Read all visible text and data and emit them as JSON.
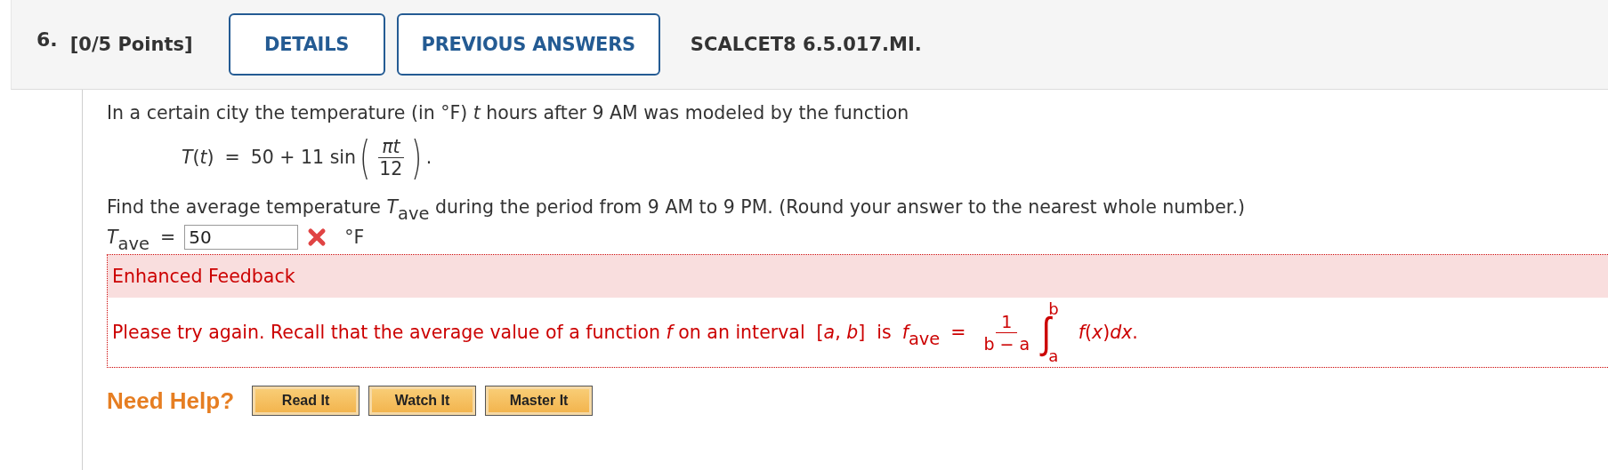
{
  "header": {
    "number": "6.",
    "points": "[0/5 Points]",
    "buttons": [
      "DETAILS",
      "PREVIOUS ANSWERS"
    ],
    "problem_id": "SCALCET8 6.5.017.MI."
  },
  "question": {
    "intro": "In a certain city the temperature (in °F) *t* hours after 9 AM was modeled by the function",
    "formula": {
      "lhs": "*T*(*t*)",
      "eq": "=",
      "rhs": "50 + 11 sin",
      "open_paren": "(",
      "numerator": "*πt*",
      "denominator": "12",
      "close_paren": ")",
      "end": "."
    },
    "prompt": "Find the average temperature *T*$_{ave}$ during the period from 9 AM to 9 PM. (Round your answer to the nearest whole number.)"
  },
  "answer": {
    "label": "*T*$_{ave}$",
    "eq": "=",
    "value": "50",
    "correct": false,
    "unit": "°F"
  },
  "feedback": {
    "title": "Enhanced Feedback",
    "message": "Please try again. Recall that the average value of a function *f* on an interval  [*a*, *b*]  is",
    "formula": {
      "lhs": "*f*$_{ave}$",
      "eq": "=",
      "numerator": "1",
      "denominator": "b − a",
      "integral": "∫",
      "upper": "b",
      "lower": "a",
      "integrand": "*f*(*x*)*dx*."
    }
  },
  "help": {
    "label": "Need Help?",
    "buttons": [
      "Read It",
      "Watch It",
      "Master It"
    ]
  }
}
